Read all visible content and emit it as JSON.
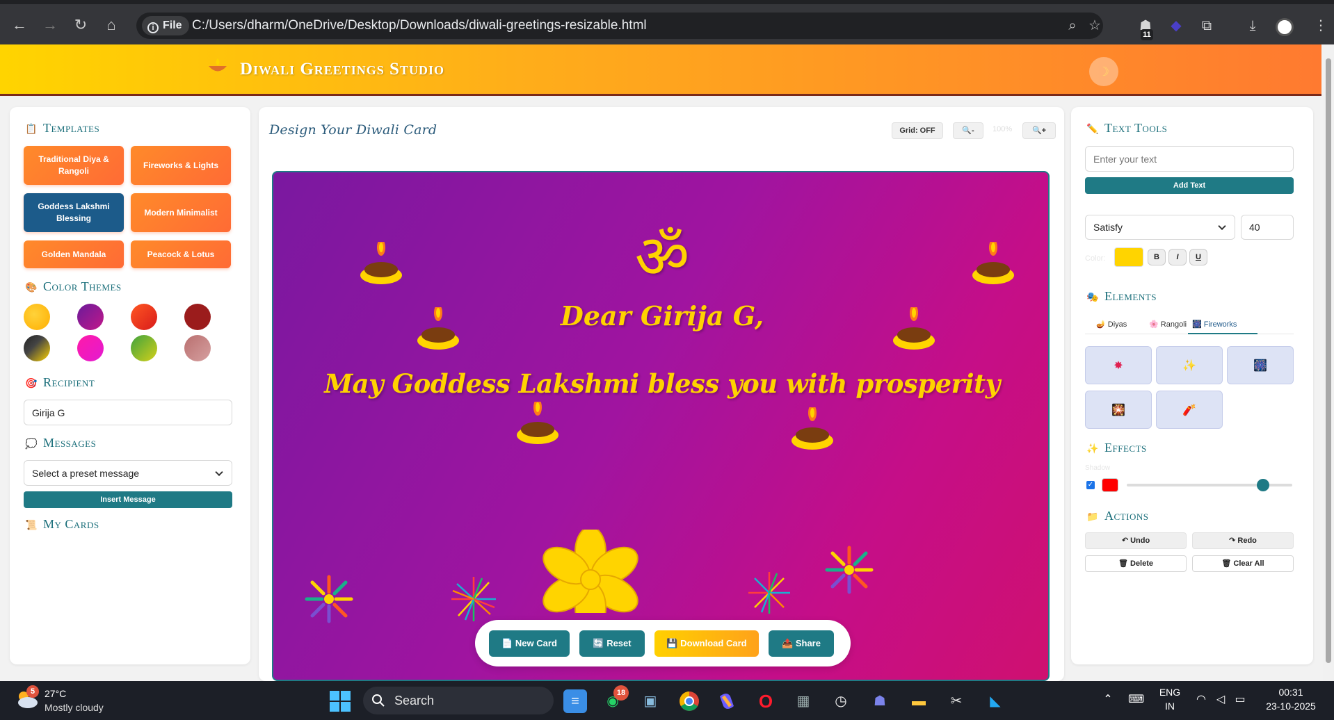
{
  "browser": {
    "address_chip": "File",
    "url": "C:/Users/dharm/OneDrive/Desktop/Downloads/diwali-greetings-resizable.html",
    "extension_badge": "11"
  },
  "header": {
    "title": "Diwali Greetings Studio"
  },
  "left": {
    "templates_title": "Templates",
    "templates": [
      "Traditional Diya & Rangoli",
      "Fireworks & Lights",
      "Goddess Lakshmi Blessing",
      "Modern Minimalist",
      "Golden Mandala",
      "Peacock & Lotus"
    ],
    "active_template": "Goddess Lakshmi Blessing",
    "color_themes_title": "Color Themes",
    "theme_colors": [
      "#ffc107",
      "#8e24aa",
      "#e53935",
      "#9b1c1c",
      "#3a3a2a",
      "#ff1aa8",
      "#7cb342",
      "#c87b7b"
    ],
    "recipient_title": "Recipient",
    "recipient_value": "Girija G",
    "messages_title": "Messages",
    "message_select": "Select a preset message",
    "insert_label": "Insert Message",
    "my_cards_title": "My Cards"
  },
  "center": {
    "design_title": "Design Your Diwali Card",
    "grid_label": "Grid: OFF",
    "zoom_out": "🔍-",
    "zoom_level": "100%",
    "zoom_in": "🔍+",
    "card": {
      "symbol": "ॐ",
      "greeting": "Dear Girija G,",
      "message": "May Goddess Lakshmi bless you with prosperity"
    },
    "actions": {
      "new_card": "New Card",
      "reset": "Reset",
      "download": "Download Card",
      "share": "Share"
    }
  },
  "right": {
    "text_tools_title": "Text Tools",
    "text_placeholder": "Enter your text",
    "add_text": "Add Text",
    "font_value": "Satisfy",
    "size_value": "40",
    "color_label": "Color:",
    "text_color": "#ffd400",
    "bold": "B",
    "italic": "I",
    "underline": "U",
    "elements_title": "Elements",
    "tabs": [
      "Diyas",
      "Rangoli",
      "Fireworks"
    ],
    "active_tab": "Fireworks",
    "effects_title": "Effects",
    "shadow_label": "Shadow",
    "shadow_color": "#ff0000",
    "shadow_level": 0.85,
    "actions_title": "Actions",
    "undo": "↶ Undo",
    "redo": "↷ Redo",
    "delete": "Delete",
    "clear_all": "Clear All"
  },
  "taskbar": {
    "weather_badge": "5",
    "temperature": "27°C",
    "weather": "Mostly cloudy",
    "search": "Search",
    "whatsapp_badge": "18",
    "lang_top": "ENG",
    "lang_bottom": "IN",
    "time": "00:31",
    "date": "23-10-2025"
  }
}
